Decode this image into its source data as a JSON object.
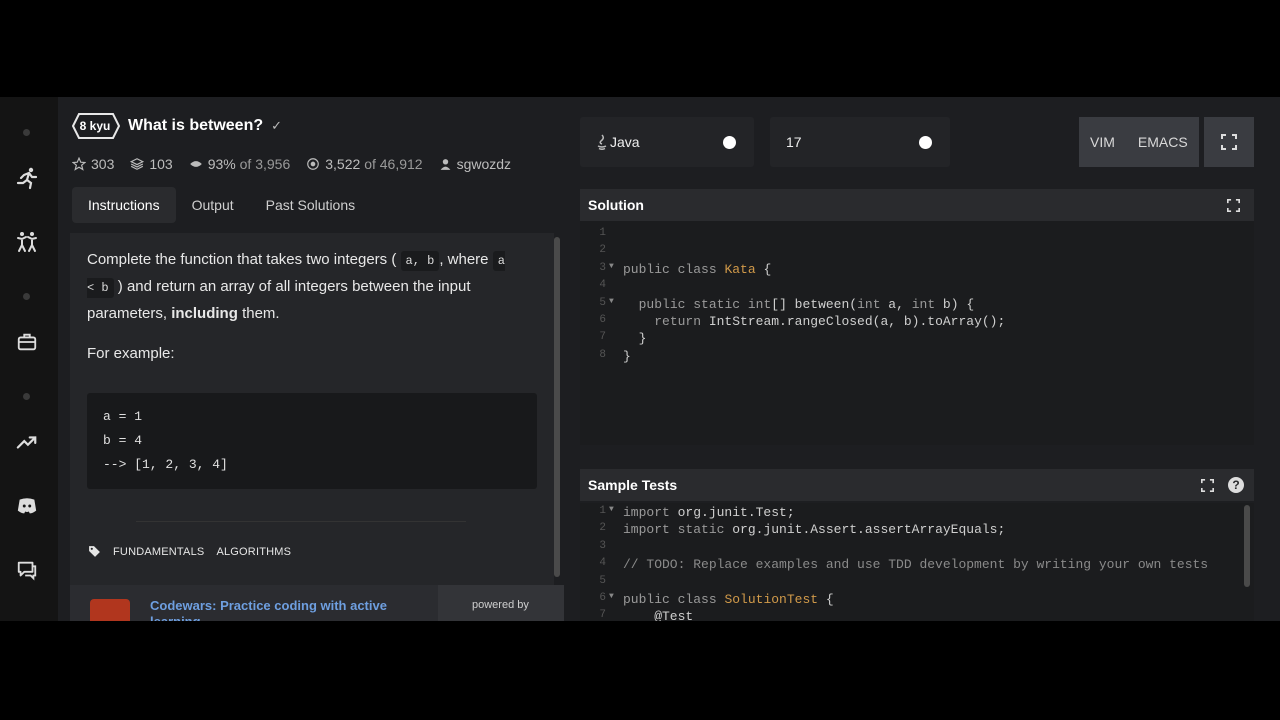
{
  "sidebar": {
    "icons": [
      "running-man-icon",
      "martial-arts-icon",
      "briefcase-icon",
      "trending-up-icon",
      "discord-icon",
      "chat-icon"
    ]
  },
  "kata": {
    "rank": "8 kyu",
    "title": "What is between?",
    "stats": {
      "stars": "303",
      "collections": "103",
      "satisfaction_pct": "93%",
      "satisfaction_of": "of 3,956",
      "completed": "3,522",
      "completed_of": "of 46,912",
      "author": "sgwozdz"
    },
    "tabs": [
      "Instructions",
      "Output",
      "Past Solutions"
    ],
    "description": {
      "p1_a": "Complete the function that takes two integers (",
      "p1_code1": "a, b",
      "p1_b": ", where",
      "p1_code2": "a < b",
      "p1_c": ") and return an array of all integers between the input parameters,",
      "p1_bold": "including",
      "p1_d": "them.",
      "p2": "For example:",
      "example": [
        "a = 1",
        "b = 4",
        "--> [1, 2, 3, 4]"
      ]
    },
    "tags": [
      "FUNDAMENTALS",
      "ALGORITHMS"
    ]
  },
  "promo": {
    "link": "Codewars: Practice coding with active learning",
    "powered_by": "powered by"
  },
  "toolbar": {
    "language": "Java",
    "version": "17",
    "vim": "VIM",
    "emacs": "EMACS"
  },
  "solution": {
    "title": "Solution",
    "lines": [
      {
        "n": "1",
        "code": ""
      },
      {
        "n": "2",
        "code": ""
      },
      {
        "n": "3",
        "code": "public class Kata {"
      },
      {
        "n": "4",
        "code": ""
      },
      {
        "n": "5",
        "code": "  public static int[] between(int a, int b) {"
      },
      {
        "n": "6",
        "code": "    return IntStream.rangeClosed(a, b).toArray();"
      },
      {
        "n": "7",
        "code": "  }"
      },
      {
        "n": "8",
        "code": "}"
      }
    ]
  },
  "tests": {
    "title": "Sample Tests",
    "lines": [
      {
        "n": "1",
        "code": "import org.junit.Test;"
      },
      {
        "n": "2",
        "code": "import static org.junit.Assert.assertArrayEquals;"
      },
      {
        "n": "3",
        "code": ""
      },
      {
        "n": "4",
        "code": "// TODO: Replace examples and use TDD development by writing your own tests"
      },
      {
        "n": "5",
        "code": ""
      },
      {
        "n": "6",
        "code": "public class SolutionTest {"
      },
      {
        "n": "7",
        "code": "    @Test"
      }
    ]
  }
}
